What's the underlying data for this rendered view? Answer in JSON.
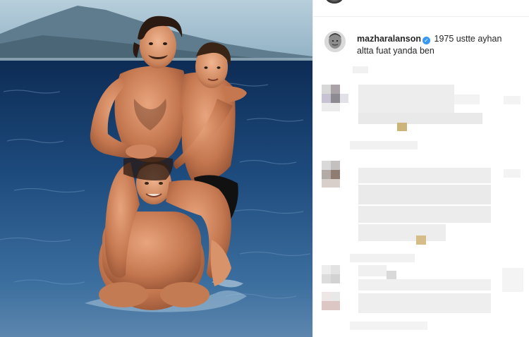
{
  "post": {
    "username": "mazharalanson",
    "caption_line1": "1975 ustte ayhan",
    "caption_line2": "altta fuat yanda ben",
    "verified_icon": "check-icon"
  },
  "colors": {
    "sea": "#2c5b8a",
    "sky": "#8fb2c9",
    "verified": "#3897f0",
    "blur_gray": "#ebebeb"
  }
}
